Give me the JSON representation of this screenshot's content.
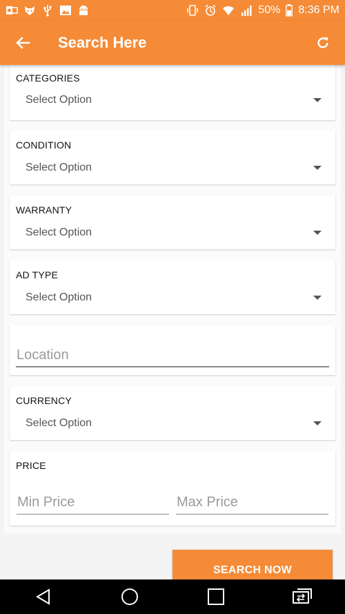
{
  "status_bar": {
    "battery": "50%",
    "time": "8:36 PM",
    "icons_left": [
      "outlook-icon",
      "fox-icon",
      "usb-icon",
      "image-icon",
      "android-icon"
    ],
    "icons_right": [
      "vibrate-icon",
      "alarm-icon",
      "wifi-icon",
      "signal-icon",
      "battery-icon"
    ]
  },
  "toolbar": {
    "title": "Search Here",
    "back_icon": "arrow-left-icon",
    "refresh_icon": "refresh-icon"
  },
  "filters": {
    "categories": {
      "label": "CATEGORIES",
      "value": "Select Option"
    },
    "condition": {
      "label": "CONDITION",
      "value": "Select Option"
    },
    "warranty": {
      "label": "WARRANTY",
      "value": "Select Option"
    },
    "ad_type": {
      "label": "AD TYPE",
      "value": "Select Option"
    },
    "location": {
      "placeholder": "Location"
    },
    "currency": {
      "label": "CURRENCY",
      "value": "Select Option"
    },
    "price": {
      "label": "PRICE",
      "min_placeholder": "Min Price",
      "max_placeholder": "Max Price"
    }
  },
  "search_button": {
    "label": "SEARCH NOW"
  },
  "nav_bar": {
    "icons": [
      "back-triangle-icon",
      "home-circle-icon",
      "recents-square-icon",
      "switch-app-icon"
    ]
  },
  "colors": {
    "accent": "#f58b37"
  }
}
